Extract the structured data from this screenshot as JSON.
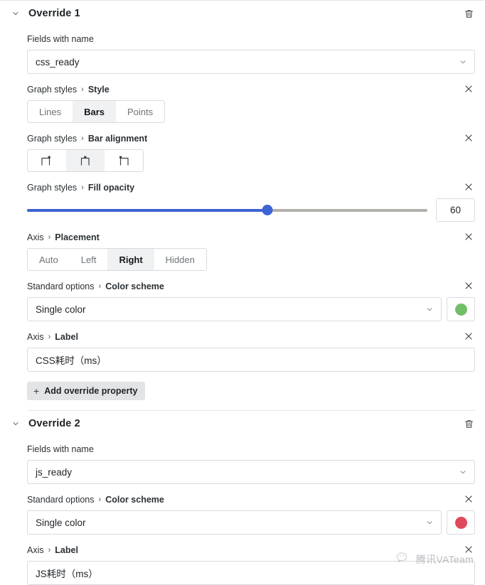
{
  "colors": {
    "accent_blue": "#3d64d4",
    "green_swatch": "#73bf69",
    "red_swatch": "#e0495b",
    "border": "#d7dade",
    "active_seg_bg": "#f0f1f2"
  },
  "watermark": {
    "text": "腾讯VATeam",
    "icon": "wechat-logo-icon"
  },
  "overrides": [
    {
      "title": "Override 1",
      "collapse_icon": "chevron-down-icon",
      "delete_icon": "trash-icon",
      "field_matcher": {
        "label": "Fields with name",
        "value": "css_ready",
        "chevron_icon": "chevron-down-icon"
      },
      "properties": [
        {
          "type": "segmented",
          "crumb_root": "Graph styles",
          "crumb_sep": "›",
          "crumb_leaf": "Style",
          "remove_icon": "close-icon",
          "options": [
            "Lines",
            "Bars",
            "Points"
          ],
          "selected": "Bars"
        },
        {
          "type": "segmented-icons",
          "crumb_root": "Graph styles",
          "crumb_sep": "›",
          "crumb_leaf": "Bar alignment",
          "remove_icon": "close-icon",
          "options": [
            "bar-align-before-icon",
            "bar-align-center-icon",
            "bar-align-after-icon"
          ],
          "selected_index": 1
        },
        {
          "type": "slider",
          "crumb_root": "Graph styles",
          "crumb_sep": "›",
          "crumb_leaf": "Fill opacity",
          "remove_icon": "close-icon",
          "value": "60",
          "percent": 60,
          "min": 0,
          "max": 100
        },
        {
          "type": "segmented",
          "crumb_root": "Axis",
          "crumb_sep": "›",
          "crumb_leaf": "Placement",
          "remove_icon": "close-icon",
          "options": [
            "Auto",
            "Left",
            "Right",
            "Hidden"
          ],
          "selected": "Right"
        },
        {
          "type": "select-color",
          "crumb_root": "Standard options",
          "crumb_sep": "›",
          "crumb_leaf": "Color scheme",
          "remove_icon": "close-icon",
          "value": "Single color",
          "chevron_icon": "chevron-down-icon",
          "swatch_color": "#73bf69",
          "swatch_name": "green"
        },
        {
          "type": "text",
          "crumb_root": "Axis",
          "crumb_sep": "›",
          "crumb_leaf": "Label",
          "remove_icon": "close-icon",
          "value": "CSS耗时（ms）"
        }
      ],
      "add_button": {
        "label": "Add override property",
        "icon": "plus-icon"
      }
    },
    {
      "title": "Override 2",
      "collapse_icon": "chevron-down-icon",
      "delete_icon": "trash-icon",
      "field_matcher": {
        "label": "Fields with name",
        "value": "js_ready",
        "chevron_icon": "chevron-down-icon"
      },
      "properties": [
        {
          "type": "select-color",
          "crumb_root": "Standard options",
          "crumb_sep": "›",
          "crumb_leaf": "Color scheme",
          "remove_icon": "close-icon",
          "value": "Single color",
          "chevron_icon": "chevron-down-icon",
          "swatch_color": "#e0495b",
          "swatch_name": "red"
        },
        {
          "type": "text",
          "crumb_root": "Axis",
          "crumb_sep": "›",
          "crumb_leaf": "Label",
          "remove_icon": "close-icon",
          "value": "JS耗时（ms）"
        }
      ]
    }
  ]
}
